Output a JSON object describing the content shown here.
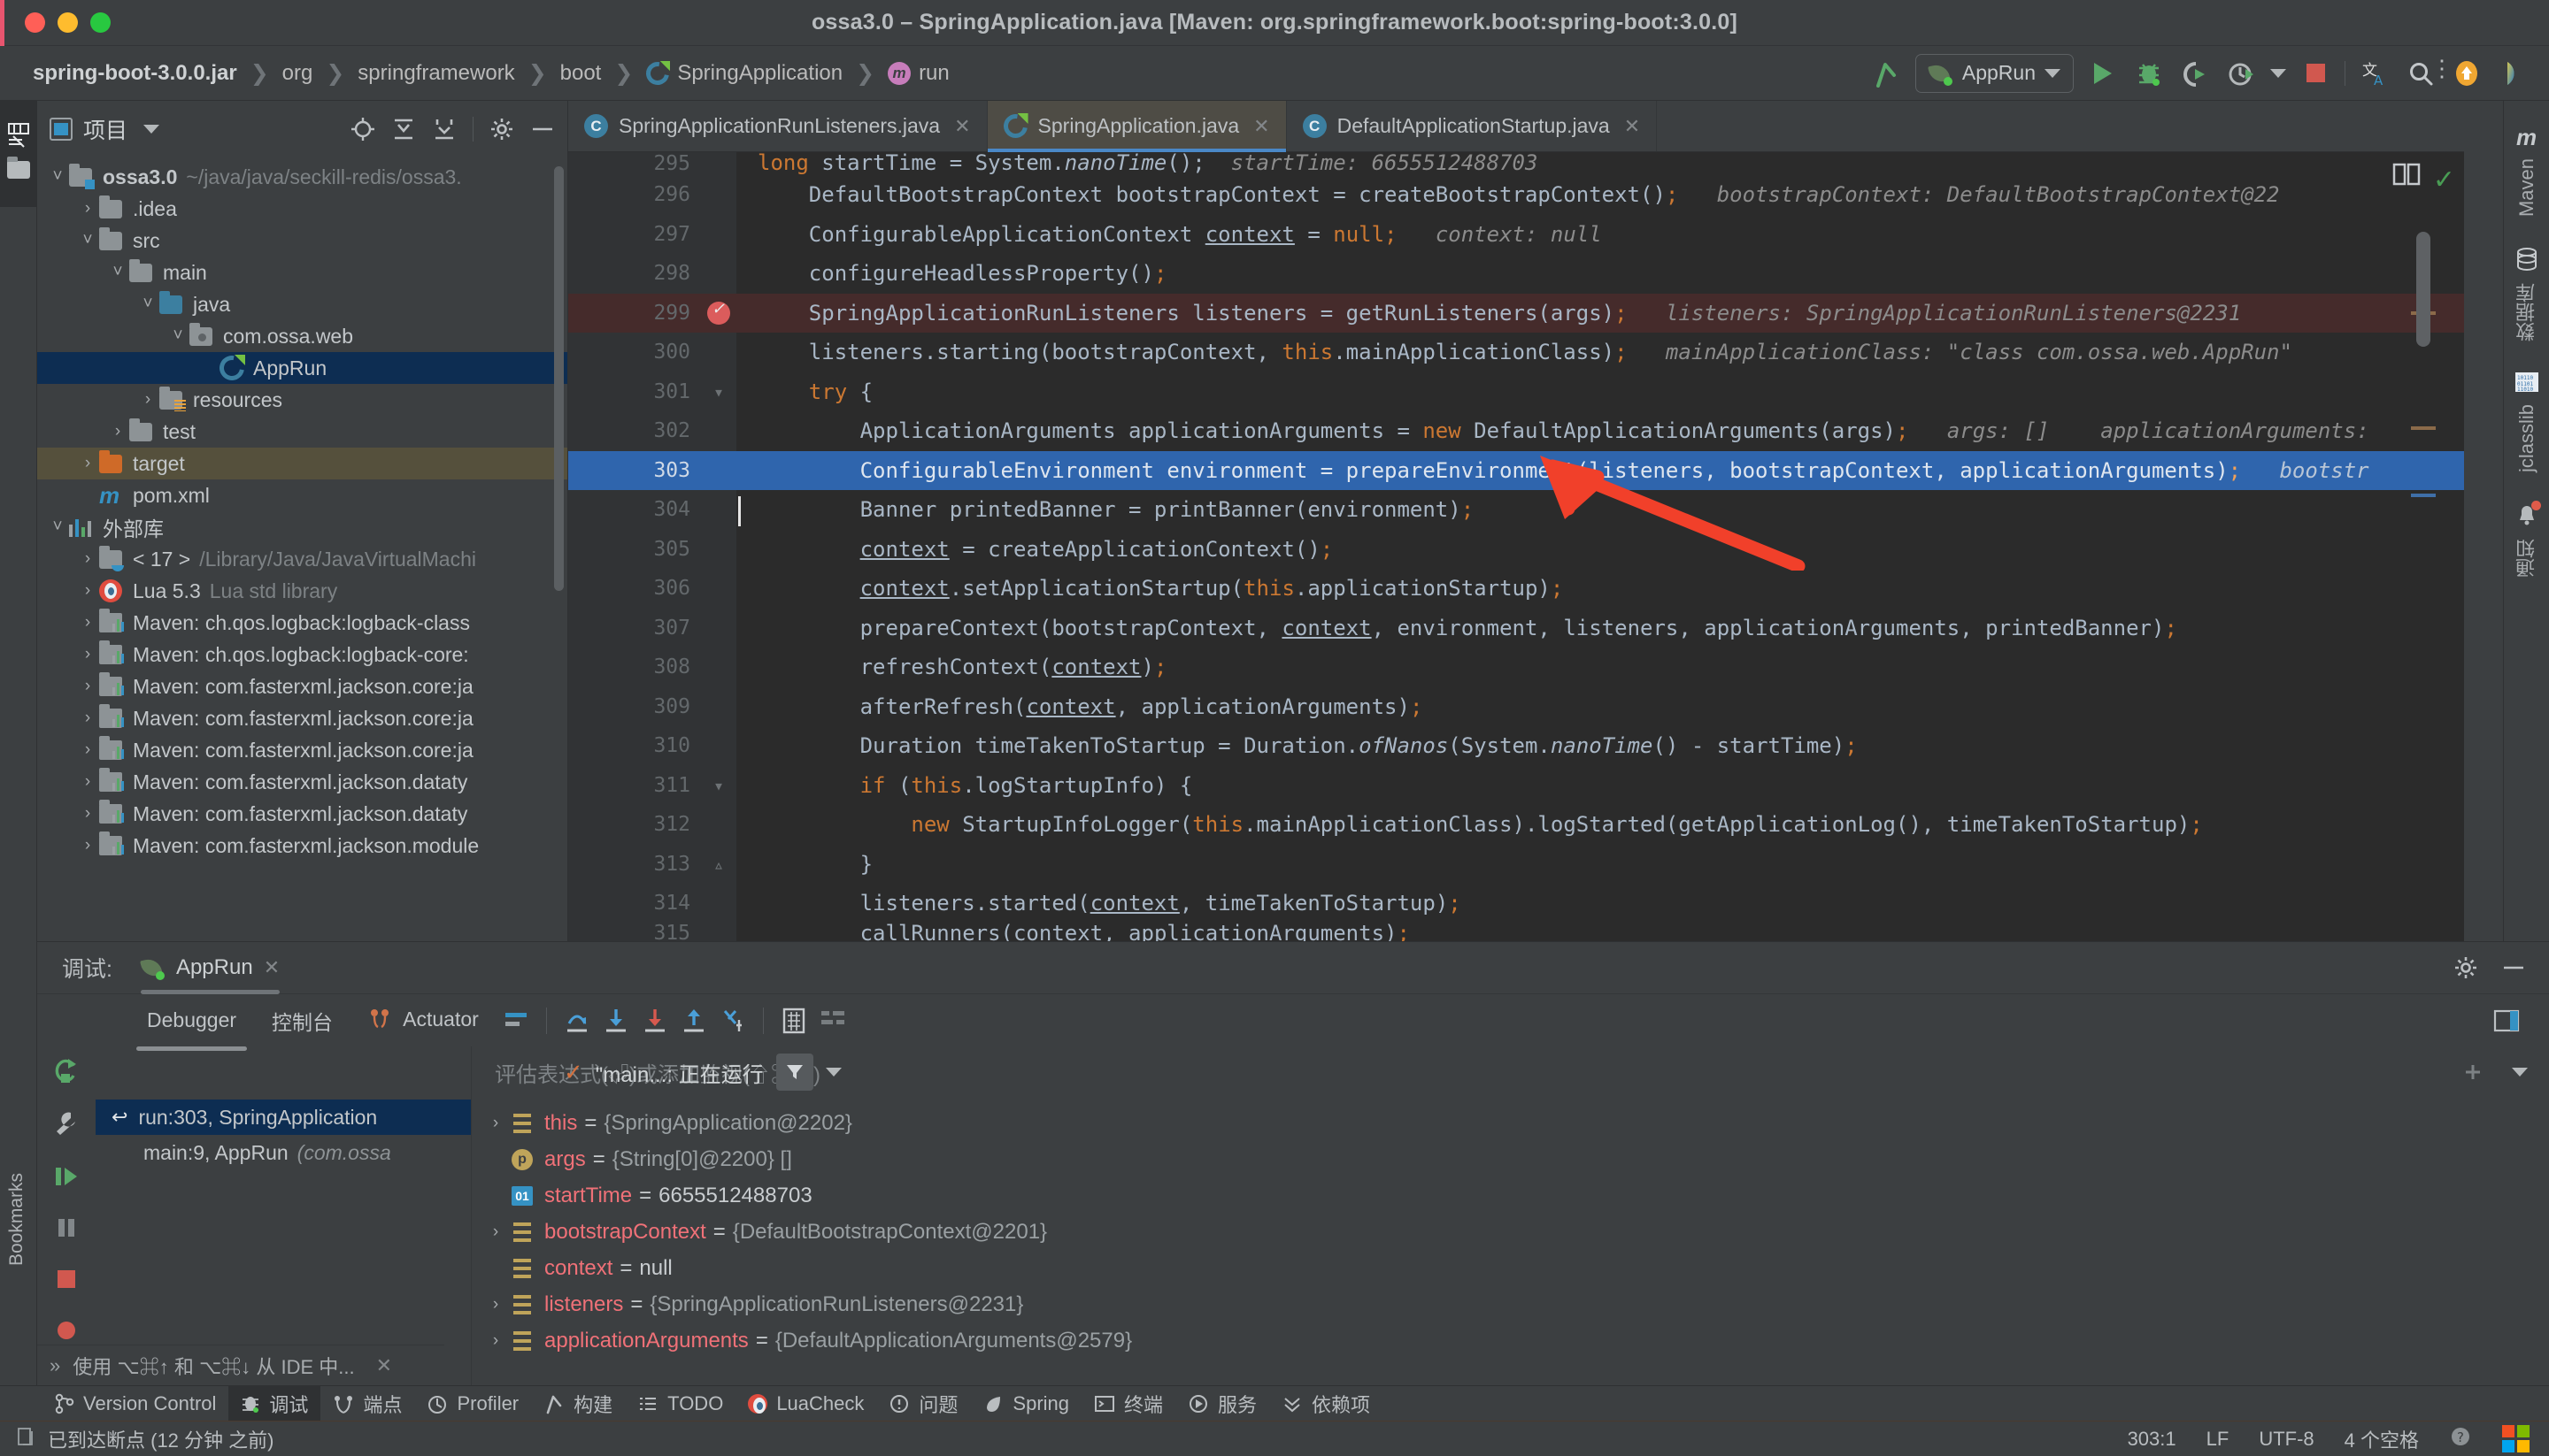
{
  "window": {
    "title": "ossa3.0 – SpringApplication.java [Maven: org.springframework.boot:spring-boot:3.0.0]"
  },
  "breadcrumb": [
    {
      "label": "spring-boot-3.0.0.jar",
      "icon": ""
    },
    {
      "label": "org",
      "icon": ""
    },
    {
      "label": "springframework",
      "icon": ""
    },
    {
      "label": "boot",
      "icon": ""
    },
    {
      "label": "SpringApplication",
      "icon": "spring-class-icon"
    },
    {
      "label": "run",
      "icon": "method-icon"
    }
  ],
  "run_toolbar": {
    "config_name": "AppRun",
    "icons": [
      "build-icon",
      "run-icon",
      "debug-icon",
      "run-with-coverage-icon",
      "profiler-icon",
      "stop-icon",
      "translate-icon",
      "search-icon",
      "update-icon",
      "ai-icon"
    ]
  },
  "project_panel": {
    "title": "项目",
    "header_icons": [
      "locate-icon",
      "expand-all-icon",
      "collapse-all-icon",
      "gear-icon",
      "hide-icon"
    ],
    "tree": [
      {
        "indent": 0,
        "arrow": "v",
        "icon": "module-folder",
        "label": "ossa3.0",
        "bold": true,
        "dim": "~/java/java/seckill-redis/ossa3."
      },
      {
        "indent": 1,
        "arrow": ">",
        "icon": "folder",
        "label": ".idea",
        "dim": ""
      },
      {
        "indent": 1,
        "arrow": "v",
        "icon": "folder",
        "label": "src",
        "dim": ""
      },
      {
        "indent": 2,
        "arrow": "v",
        "icon": "folder",
        "label": "main",
        "dim": ""
      },
      {
        "indent": 3,
        "arrow": "v",
        "icon": "source-folder",
        "label": "java",
        "dim": ""
      },
      {
        "indent": 4,
        "arrow": "v",
        "icon": "package-folder",
        "label": "com.ossa.web",
        "dim": ""
      },
      {
        "indent": 5,
        "arrow": "",
        "icon": "spring-class-icon",
        "label": "AppRun",
        "dim": "",
        "selected": "blue"
      },
      {
        "indent": 4,
        "arrow": ">",
        "icon": "resources-folder",
        "label": "resources",
        "dim": ""
      },
      {
        "indent": 3,
        "arrow": ">",
        "icon": "folder",
        "label": "test",
        "dim": ""
      },
      {
        "indent": 2,
        "arrow": ">",
        "icon": "target-folder",
        "label": "target",
        "dim": "",
        "selected": "tan"
      },
      {
        "indent": 2,
        "arrow": "",
        "icon": "maven-xml-icon",
        "label": "pom.xml",
        "dim": ""
      },
      {
        "indent": 0,
        "arrow": "v",
        "icon": "external-libraries-icon",
        "label": "外部库",
        "dim": ""
      },
      {
        "indent": 1,
        "arrow": ">",
        "icon": "jdk-folder",
        "label": "< 17 >",
        "dim": "/Library/Java/JavaVirtualMachi"
      },
      {
        "indent": 1,
        "arrow": ">",
        "icon": "lua-icon",
        "label": "Lua 5.3",
        "dim": "Lua std library"
      },
      {
        "indent": 1,
        "arrow": ">",
        "icon": "maven-lib-icon",
        "label": "Maven: ch.qos.logback:logback-class",
        "dim": ""
      },
      {
        "indent": 1,
        "arrow": ">",
        "icon": "maven-lib-icon",
        "label": "Maven: ch.qos.logback:logback-core:",
        "dim": ""
      },
      {
        "indent": 1,
        "arrow": ">",
        "icon": "maven-lib-icon",
        "label": "Maven: com.fasterxml.jackson.core:ja",
        "dim": ""
      },
      {
        "indent": 1,
        "arrow": ">",
        "icon": "maven-lib-icon",
        "label": "Maven: com.fasterxml.jackson.core:ja",
        "dim": ""
      },
      {
        "indent": 1,
        "arrow": ">",
        "icon": "maven-lib-icon",
        "label": "Maven: com.fasterxml.jackson.core:ja",
        "dim": ""
      },
      {
        "indent": 1,
        "arrow": ">",
        "icon": "maven-lib-icon",
        "label": "Maven: com.fasterxml.jackson.dataty",
        "dim": ""
      },
      {
        "indent": 1,
        "arrow": ">",
        "icon": "maven-lib-icon",
        "label": "Maven: com.fasterxml.jackson.dataty",
        "dim": ""
      },
      {
        "indent": 1,
        "arrow": ">",
        "icon": "maven-lib-icon",
        "label": "Maven: com.fasterxml.jackson.module",
        "dim": ""
      }
    ]
  },
  "left_strip": {
    "labels": [
      "项目"
    ]
  },
  "editor": {
    "tabs": [
      {
        "label": "SpringApplicationRunListeners.java",
        "icon": "class-icon",
        "active": false
      },
      {
        "label": "SpringApplication.java",
        "icon": "spring-class-icon",
        "active": true
      },
      {
        "label": "DefaultApplicationStartup.java",
        "icon": "class-icon",
        "active": false
      }
    ],
    "lines": [
      {
        "no": "295",
        "partial": true
      },
      {
        "no": "296"
      },
      {
        "no": "297"
      },
      {
        "no": "298"
      },
      {
        "no": "299",
        "breakpoint": true
      },
      {
        "no": "300"
      },
      {
        "no": "301",
        "fold": true
      },
      {
        "no": "302"
      },
      {
        "no": "303",
        "current": true
      },
      {
        "no": "304"
      },
      {
        "no": "305"
      },
      {
        "no": "306"
      },
      {
        "no": "307"
      },
      {
        "no": "308"
      },
      {
        "no": "309"
      },
      {
        "no": "310"
      },
      {
        "no": "311",
        "fold": true
      },
      {
        "no": "312"
      },
      {
        "no": "313",
        "fold": true
      },
      {
        "no": "314"
      },
      {
        "no": "315",
        "partial": true
      }
    ],
    "code": {
      "l295": "long startTime = System.nanoTime();",
      "l295_hint": "startTime: 6655512488703",
      "l296": "DefaultBootstrapContext bootstrapContext = createBootstrapContext();",
      "l296_hint": "bootstrapContext: DefaultBootstrapContext@22",
      "l297": "ConfigurableApplicationContext context = null;",
      "l297_hint": "context: null",
      "l298": "configureHeadlessProperty();",
      "l299": "SpringApplicationRunListeners listeners = getRunListeners(args);",
      "l299_hint": "listeners: SpringApplicationRunListeners@2231",
      "l300": "listeners.starting(bootstrapContext, this.mainApplicationClass);",
      "l300_hint": "mainApplicationClass: \"class com.ossa.web.AppRun\"",
      "l301": "try {",
      "l302": "ApplicationArguments applicationArguments = new DefaultApplicationArguments(args);",
      "l302_hint": "args: []",
      "l302_hint2": "applicationArguments:",
      "l303": "ConfigurableEnvironment environment = prepareEnvironment(listeners, bootstrapContext, applicationArguments);",
      "l303_hint": "bootstra",
      "l304": "Banner printedBanner = printBanner(environment);",
      "l305": "context = createApplicationContext();",
      "l306": "context.setApplicationStartup(this.applicationStartup);",
      "l307": "prepareContext(bootstrapContext, context, environment, listeners, applicationArguments, printedBanner);",
      "l308": "refreshContext(context);",
      "l309": "afterRefresh(context, applicationArguments);",
      "l310": "Duration timeTakenToStartup = Duration.ofNanos(System.nanoTime() - startTime);",
      "l311": "if (this.logStartupInfo) {",
      "l312": "new StartupInfoLogger(this.mainApplicationClass).logStarted(getApplicationLog(), timeTakenToStartup);",
      "l313": "}",
      "l314": "listeners.started(context, timeTakenToStartup);",
      "l315": "callRunners(context, applicationArguments);"
    }
  },
  "right_strip": {
    "items": [
      {
        "label": "Maven",
        "icon": "maven-icon"
      },
      {
        "label": "数据库",
        "icon": "database-icon"
      },
      {
        "label": "jclasslib",
        "icon": "jclasslib-icon"
      },
      {
        "label": "通知",
        "icon": "notifications-icon",
        "badge": true
      }
    ]
  },
  "debug_panel": {
    "header_label": "调试:",
    "session_name": "AppRun",
    "tabs": [
      {
        "label": "Debugger",
        "active": true
      },
      {
        "label": "控制台",
        "active": false
      },
      {
        "label": "Actuator",
        "active": false,
        "icon": "actuator-icon"
      }
    ],
    "step_icons": [
      "show-execution-point-icon",
      "step-over-icon",
      "step-into-icon",
      "force-step-into-icon",
      "step-out-icon",
      "run-to-cursor-icon",
      "evaluate-icon",
      "layout-icon"
    ],
    "thread": "\"main...: 正在运行",
    "watch_placeholder": "评估表达式(⏎)或添加监视(⇧⌘⏎)",
    "frames": [
      {
        "label": "run:303, SpringApplication",
        "selected": true,
        "icon": "return-icon"
      },
      {
        "label": "main:9, AppRun",
        "italic": "(com.ossa",
        "selected": false
      }
    ],
    "variables": [
      {
        "arrow": ">",
        "icon": "field-icon",
        "name": "this",
        "value": "{SpringApplication@2202}",
        "dim": true
      },
      {
        "arrow": "",
        "icon": "param-icon",
        "name": "args",
        "value": "{String[0]@2200} []",
        "dim": true
      },
      {
        "arrow": "",
        "icon": "primitive-icon",
        "name": "startTime",
        "value": "6655512488703",
        "dim": false
      },
      {
        "arrow": ">",
        "icon": "field-icon",
        "name": "bootstrapContext",
        "value": "{DefaultBootstrapContext@2201}",
        "dim": true
      },
      {
        "arrow": "",
        "icon": "field-icon",
        "name": "context",
        "value": "null",
        "dim": false
      },
      {
        "arrow": ">",
        "icon": "field-icon",
        "name": "listeners",
        "value": "{SpringApplicationRunListeners@2231}",
        "dim": true
      },
      {
        "arrow": ">",
        "icon": "field-icon",
        "name": "applicationArguments",
        "value": "{DefaultApplicationArguments@2579}",
        "dim": true
      }
    ],
    "bottom_hint": "使用 ⌥⌘↑ 和 ⌥⌘↓ 从 IDE 中..."
  },
  "bottom_bar": {
    "items": [
      {
        "label": "Version Control",
        "icon": "vcs-icon",
        "active": false
      },
      {
        "label": "调试",
        "icon": "debug-icon",
        "active": true
      },
      {
        "label": "端点",
        "icon": "endpoints-icon",
        "active": false
      },
      {
        "label": "Profiler",
        "icon": "profiler-icon",
        "active": false
      },
      {
        "label": "构建",
        "icon": "build-icon",
        "active": false
      },
      {
        "label": "TODO",
        "icon": "todo-icon",
        "active": false
      },
      {
        "label": "LuaCheck",
        "icon": "lua-icon",
        "active": false
      },
      {
        "label": "问题",
        "icon": "problems-icon",
        "active": false
      },
      {
        "label": "Spring",
        "icon": "spring-icon",
        "active": false
      },
      {
        "label": "终端",
        "icon": "terminal-icon",
        "active": false
      },
      {
        "label": "服务",
        "icon": "services-icon",
        "active": false
      },
      {
        "label": "依赖项",
        "icon": "dependencies-icon",
        "active": false
      }
    ]
  },
  "status_bar": {
    "message": "已到达断点 (12 分钟 之前)",
    "caret": "303:1",
    "line_sep": "LF",
    "encoding": "UTF-8",
    "indent": "4 个空格",
    "icons": [
      "help-icon",
      "windows-icon"
    ]
  }
}
